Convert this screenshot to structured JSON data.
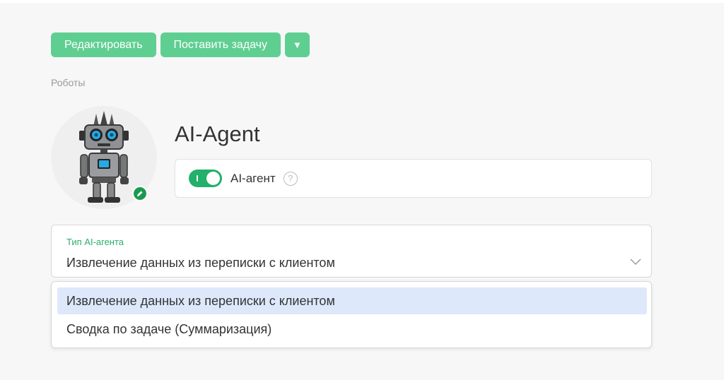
{
  "toolbar": {
    "edit_label": "Редактировать",
    "task_label": "Поставить задачу",
    "more_icon": "caret-down-icon"
  },
  "breadcrumb": "Роботы",
  "agent": {
    "name": "AI-Agent",
    "avatar_icon": "robot-icon",
    "edit_icon": "pencil-icon",
    "toggle_label": "AI-агент",
    "toggle_on": true,
    "help_icon": "question-icon",
    "help_glyph": "?"
  },
  "agent_type": {
    "label": "Тип AI-агента",
    "value": "Извлечение данных из переписки с клиентом",
    "options": [
      "Извлечение данных из переписки с клиентом",
      "Сводка по задаче (Суммаризация)"
    ],
    "selected_index": 0
  },
  "colors": {
    "accent": "#5fcf91",
    "toggle_on": "#22b06a",
    "field_label": "#2dae6b",
    "selected_option": "#dde9fb",
    "background": "#f7f7f7"
  }
}
